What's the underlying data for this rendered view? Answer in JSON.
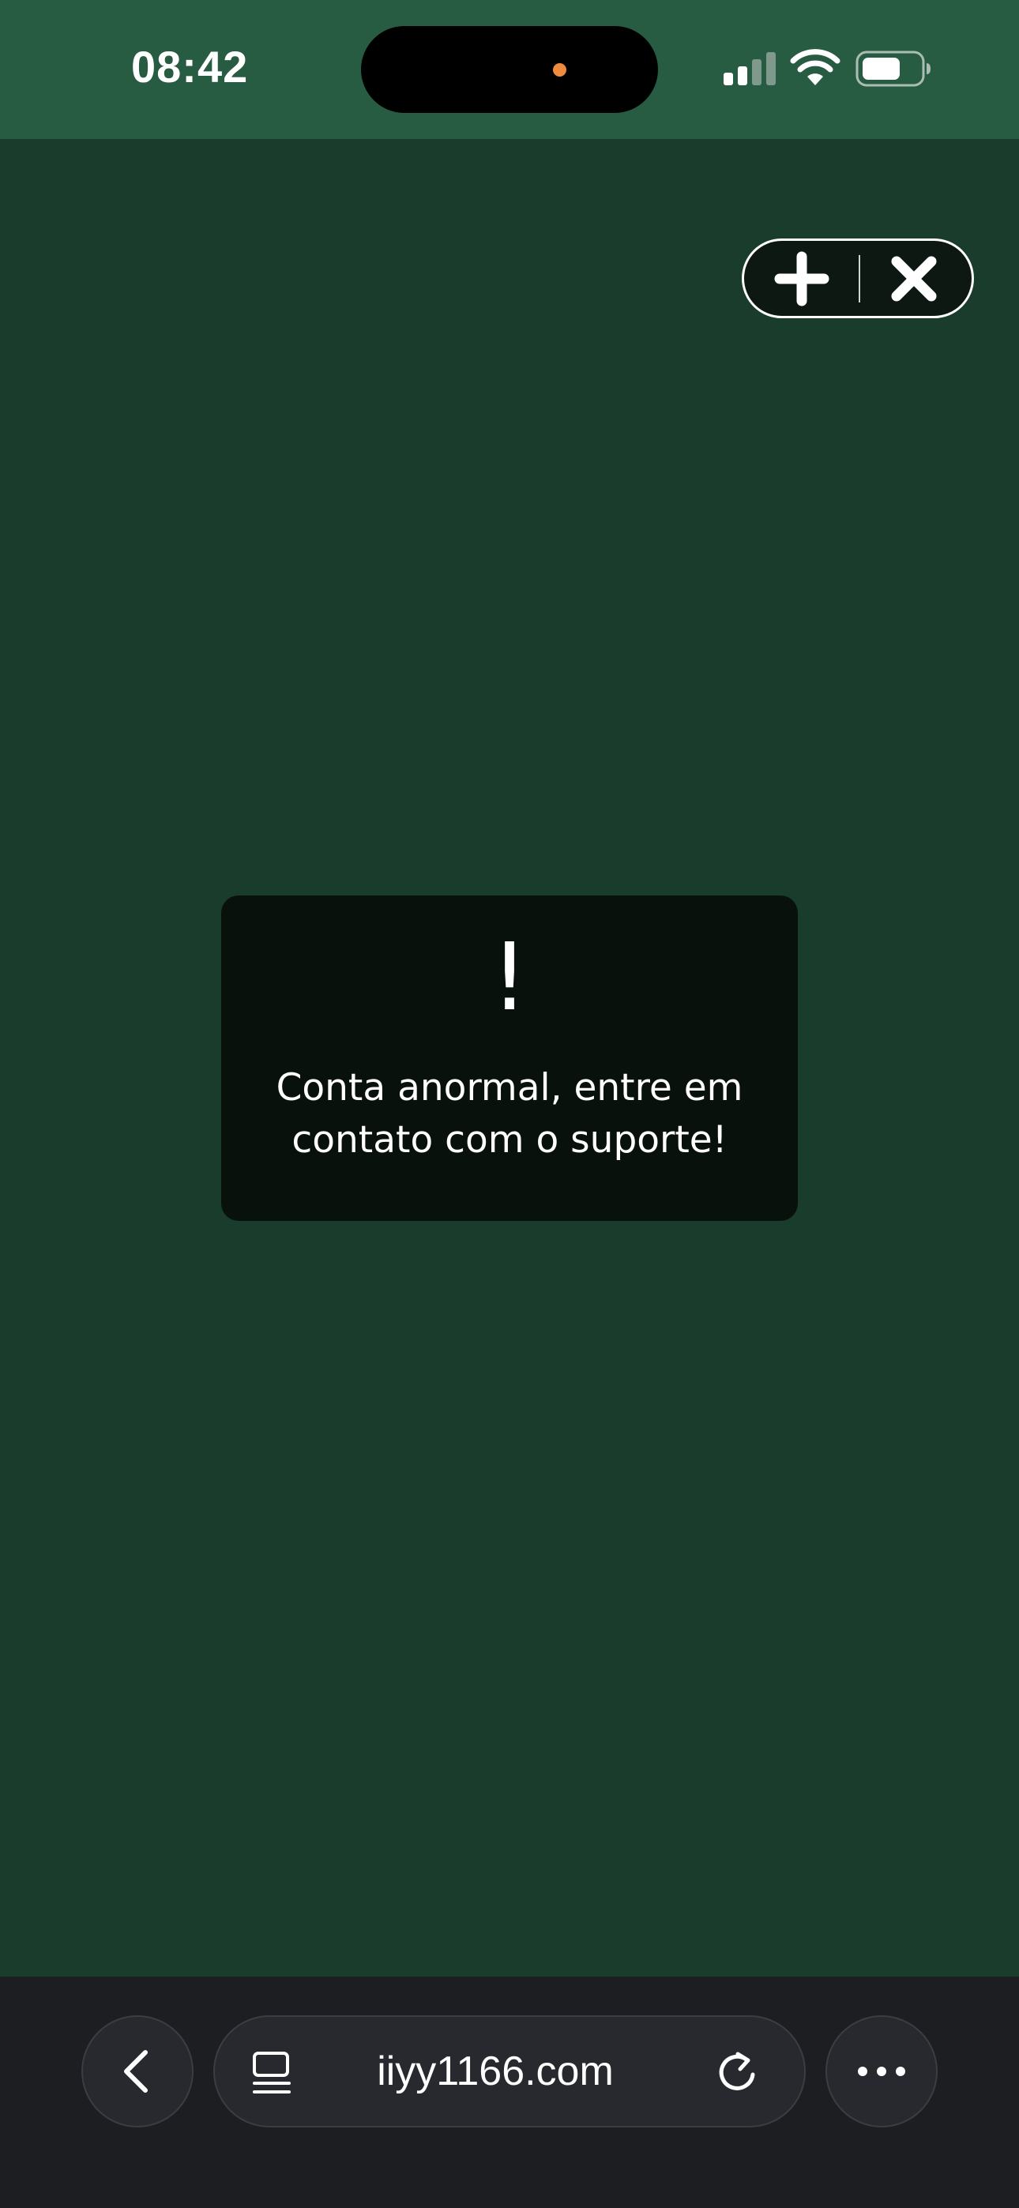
{
  "status_bar": {
    "time": "08:42",
    "privacy_dot_color": "#f08a3e"
  },
  "capsule": {
    "add_icon": "plus-icon",
    "close_icon": "close-icon"
  },
  "toast": {
    "icon": "exclamation",
    "mark": "!",
    "message": "Conta anormal, entre em contato com o suporte!"
  },
  "browser_bar": {
    "back_icon": "chevron-left-icon",
    "tabs_icon": "tabs-icon",
    "url": "iiyy1166.com",
    "reload_icon": "reload-icon",
    "more_icon": "more-icon"
  },
  "colors": {
    "page_background": "#1a3c2c",
    "status_bar_background": "#275c42",
    "toast_background": "#08110c",
    "browser_bar_background": "#1d1e22"
  }
}
